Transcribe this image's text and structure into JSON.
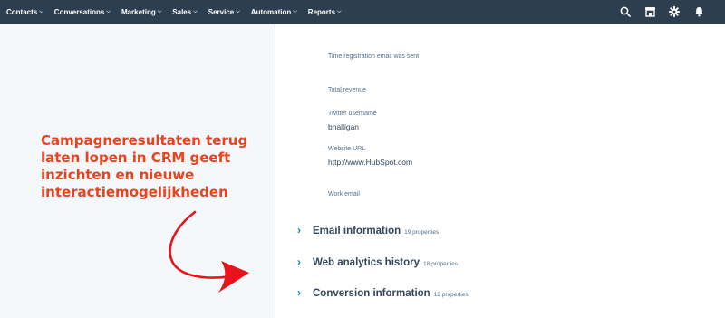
{
  "nav": {
    "items": [
      {
        "label": "Contacts"
      },
      {
        "label": "Conversations"
      },
      {
        "label": "Marketing"
      },
      {
        "label": "Sales"
      },
      {
        "label": "Service"
      },
      {
        "label": "Automation"
      },
      {
        "label": "Reports"
      }
    ],
    "chevron": "⌵",
    "icons": [
      "search-icon",
      "marketplace-icon",
      "settings-gear-icon",
      "notifications-bell-icon"
    ],
    "background": "#2d3e50"
  },
  "callout": {
    "text": "Campagneresultaten terug laten lopen in CRM geeft inzichten en nieuwe interactiemogelijkheden",
    "color": "#e8421e"
  },
  "properties": [
    {
      "label": "Time registration email was sent",
      "value": ""
    },
    {
      "label": "Total revenue",
      "value": ""
    },
    {
      "label": "Twitter username",
      "value": "bhalligan"
    },
    {
      "label": "Website URL",
      "value": "http://www.HubSpot.com"
    },
    {
      "label": "Work email",
      "value": ""
    }
  ],
  "sections": [
    {
      "title": "Email information",
      "count": "19 properties"
    },
    {
      "title": "Web analytics history",
      "count": "18 properties"
    },
    {
      "title": "Conversion information",
      "count": "12 properties"
    }
  ],
  "caret": "›"
}
